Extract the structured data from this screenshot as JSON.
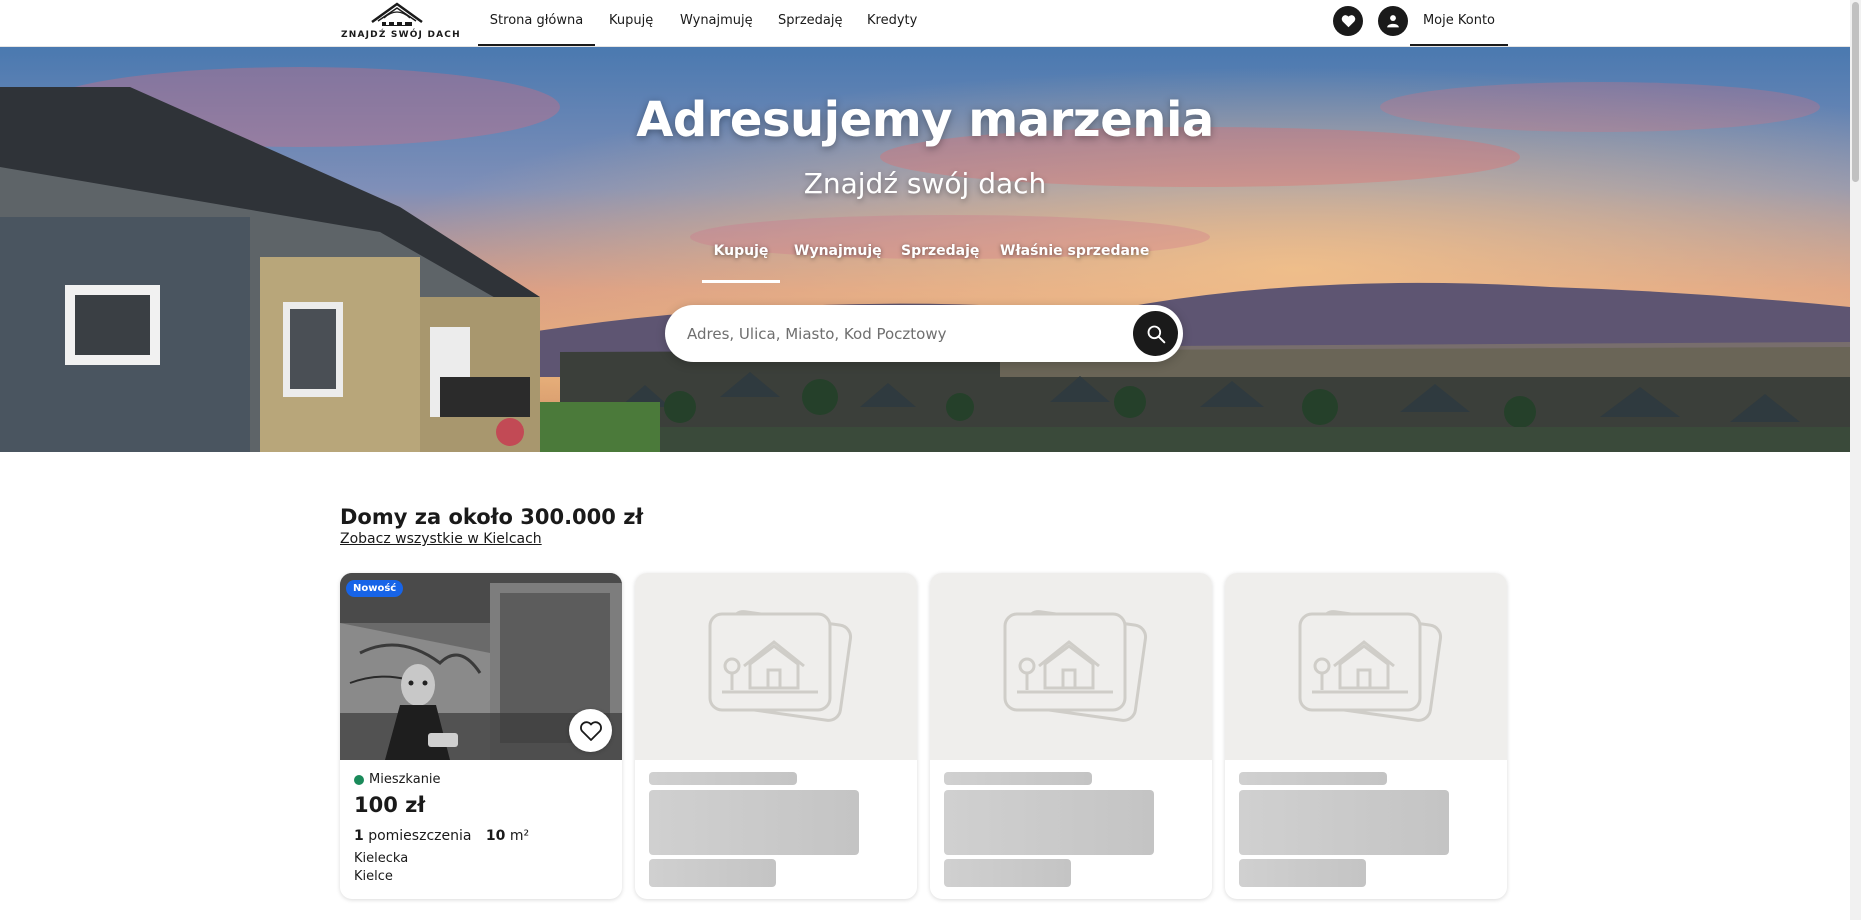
{
  "logo": {
    "text": "ZNAJDŹ SWÓJ DACH",
    "icon": "house-roof-logo-icon"
  },
  "nav": {
    "items": [
      {
        "label": "Strona główna",
        "active": true
      },
      {
        "label": "Kupuję",
        "active": false
      },
      {
        "label": "Wynajmuję",
        "active": false
      },
      {
        "label": "Sprzedaję",
        "active": false
      },
      {
        "label": "Kredyty",
        "active": false
      }
    ],
    "favorites_icon": "heart-icon",
    "user_icon": "user-icon",
    "account_label": "Moje Konto"
  },
  "hero": {
    "title": "Adresujemy marzenia",
    "subtitle": "Znajdź swój dach",
    "tabs": [
      {
        "label": "Kupuję",
        "active": true
      },
      {
        "label": "Wynajmuję",
        "active": false
      },
      {
        "label": "Sprzedaję",
        "active": false
      },
      {
        "label": "Właśnie sprzedane",
        "active": false
      }
    ],
    "search": {
      "placeholder": "Adres, Ulica, Miasto, Kod Pocztowy",
      "value": "",
      "icon": "search-icon"
    }
  },
  "listings": {
    "title": "Domy za około 300.000 zł",
    "link": "Zobacz wszystkie w Kielcach",
    "cards": [
      {
        "badge": "Nowość",
        "type": "Mieszkanie",
        "type_color": "#1a8a5a",
        "price": "100 zł",
        "rooms_count": "1",
        "rooms_label": "pomieszczenia",
        "area_value": "10",
        "area_unit": "m²",
        "street": "Kielecka",
        "city": "Kielce"
      }
    ],
    "placeholder_count": 3,
    "placeholder_icon": "photo-placeholder-icon"
  },
  "colors": {
    "accent": "#1764e8",
    "dark": "#1a1a1a",
    "status_green": "#1a8a5a"
  }
}
